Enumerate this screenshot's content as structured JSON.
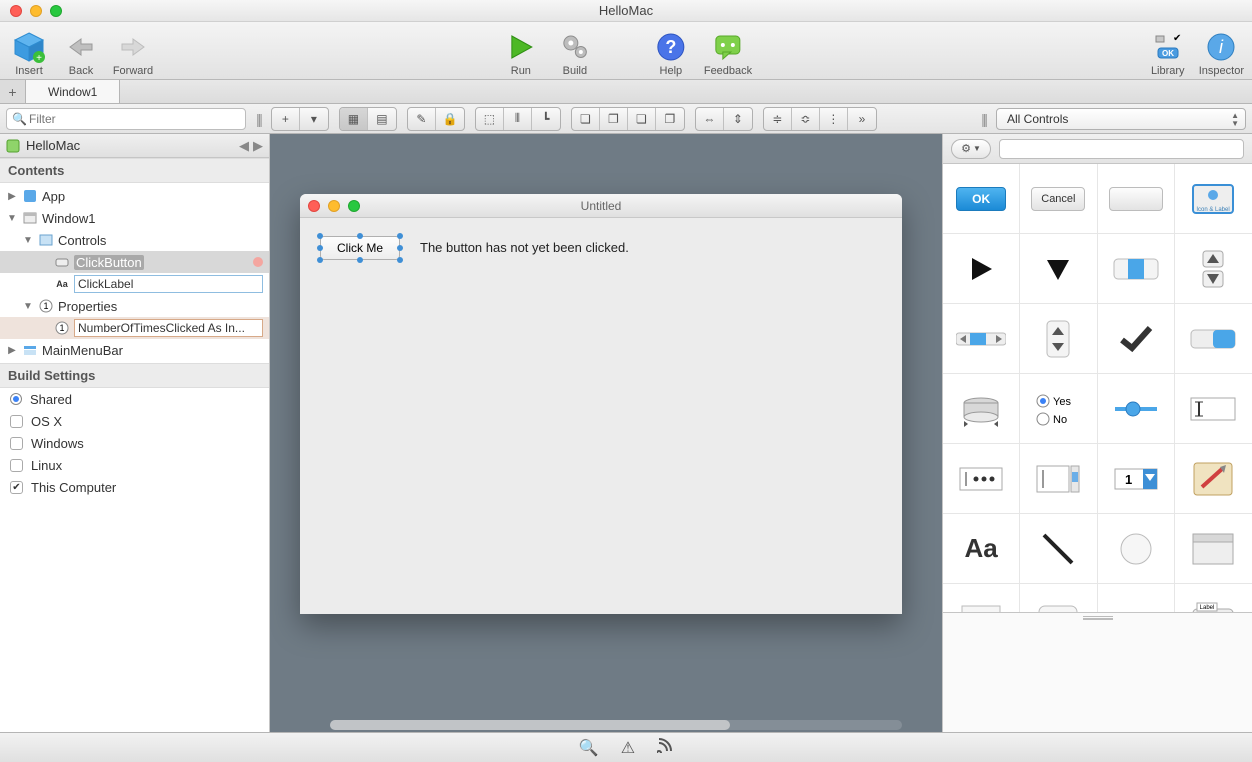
{
  "window": {
    "title": "HelloMac"
  },
  "toolbar": {
    "insert": "Insert",
    "back": "Back",
    "forward": "Forward",
    "run": "Run",
    "build": "Build",
    "help": "Help",
    "feedback": "Feedback",
    "library": "Library",
    "inspector": "Inspector"
  },
  "tabs": {
    "active": "Window1"
  },
  "filter": {
    "placeholder": "Filter"
  },
  "navigator": {
    "project": "HelloMac",
    "contents_header": "Contents",
    "items": {
      "app": "App",
      "window1": "Window1",
      "controls": "Controls",
      "clickbutton": "ClickButton",
      "clicklabel": "ClickLabel",
      "properties": "Properties",
      "number_of_times": "NumberOfTimesClicked As In...",
      "mainmenubar": "MainMenuBar"
    },
    "build_settings_header": "Build Settings",
    "build_settings": {
      "shared": "Shared",
      "osx": "OS X",
      "windows": "Windows",
      "linux": "Linux",
      "this_computer": "This Computer"
    }
  },
  "canvas": {
    "window_title": "Untitled",
    "button_label": "Click Me",
    "label_text": "The button has not yet been clicked."
  },
  "library_panel": {
    "dropdown": "All Controls",
    "search_placeholder": "",
    "ok": "OK",
    "cancel": "Cancel",
    "yes": "Yes",
    "no": "No",
    "aa": "Aa",
    "one": "1",
    "label_caption": "Label",
    "icon_label": "Icon & Label"
  }
}
